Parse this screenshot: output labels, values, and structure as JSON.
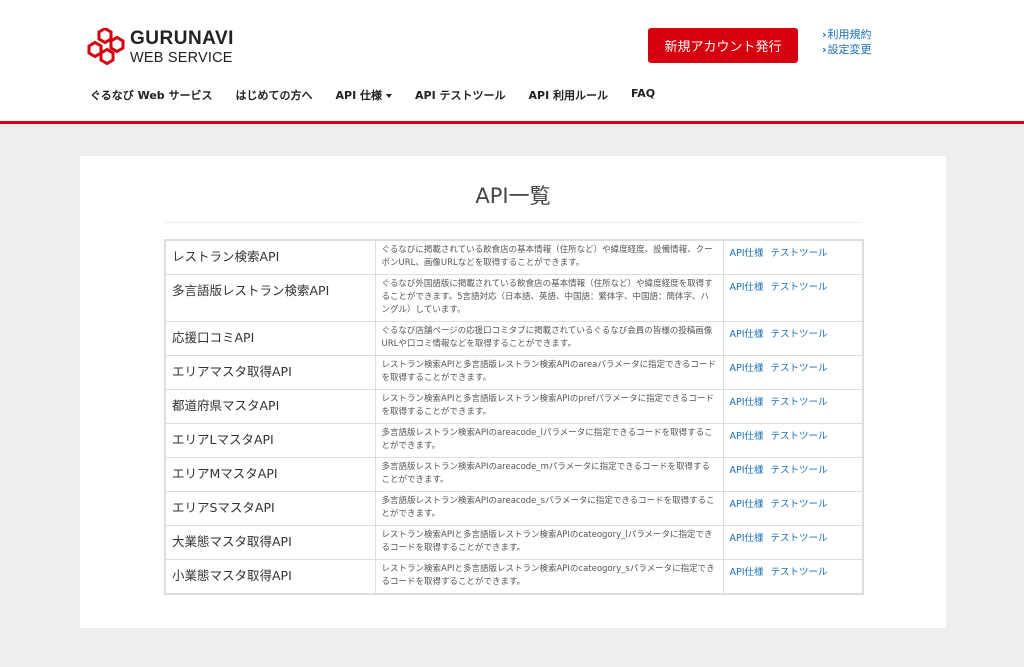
{
  "brand": {
    "name": "GURUNAVI",
    "subtitle": "WEB SERVICE",
    "accent_color": "#d7000f"
  },
  "header": {
    "signup_label": "新規アカウント発行",
    "links": [
      "利用規約",
      "設定変更"
    ]
  },
  "nav": [
    {
      "label": "ぐるなび Web サービス"
    },
    {
      "label": "はじめての方へ"
    },
    {
      "label": "API 仕様",
      "dropdown": true
    },
    {
      "label": "API テストツール"
    },
    {
      "label": "API 利用ルール"
    },
    {
      "label": "FAQ"
    }
  ],
  "page": {
    "title": "API一覧"
  },
  "table": {
    "link_spec": "API仕様",
    "link_test": "テストツール",
    "rows": [
      {
        "name": "レストラン検索API",
        "desc": "ぐるなびに掲載されている飲食店の基本情報（住所など）や緯度経度、設備情報、クーポンURL、画像URLなどを取得することができます。"
      },
      {
        "name": "多言語版レストラン検索API",
        "desc": "ぐるなび外国語版に掲載されている飲食店の基本情報（住所など）や緯度経度を取得することができます。5言語対応（日本語、英語、中国語：繁体字、中国語：簡体字、ハングル）しています。"
      },
      {
        "name": "応援口コミAPI",
        "desc": "ぐるなび店舗ページの応援口コミタブに掲載されているぐるなび会員の皆様の投稿画像URLや口コミ情報などを取得することができます。"
      },
      {
        "name": "エリアマスタ取得API",
        "desc": "レストラン検索APIと多言語版レストラン検索APIのareaパラメータに指定できるコードを取得することができます。"
      },
      {
        "name": "都道府県マスタAPI",
        "desc": "レストラン検索APIと多言語版レストラン検索APIのprefパラメータに指定できるコードを取得することができます。"
      },
      {
        "name": "エリアLマスタAPI",
        "desc": "多言語版レストラン検索APIのareacode_lパラメータに指定できるコードを取得することができます。"
      },
      {
        "name": "エリアMマスタAPI",
        "desc": "多言語版レストラン検索APIのareacode_mパラメータに指定できるコードを取得することができます。"
      },
      {
        "name": "エリアSマスタAPI",
        "desc": "多言語版レストラン検索APIのareacode_sパラメータに指定できるコードを取得することができます。"
      },
      {
        "name": "大業態マスタ取得API",
        "desc": "レストラン検索APIと多言語版レストラン検索APIのcateogory_lパラメータに指定できるコードを取得することができます。"
      },
      {
        "name": "小業態マスタ取得API",
        "desc": "レストラン検索APIと多言語版レストラン検索APIのcateogory_sパラメータに指定できるコードを取得することができます。"
      }
    ]
  }
}
